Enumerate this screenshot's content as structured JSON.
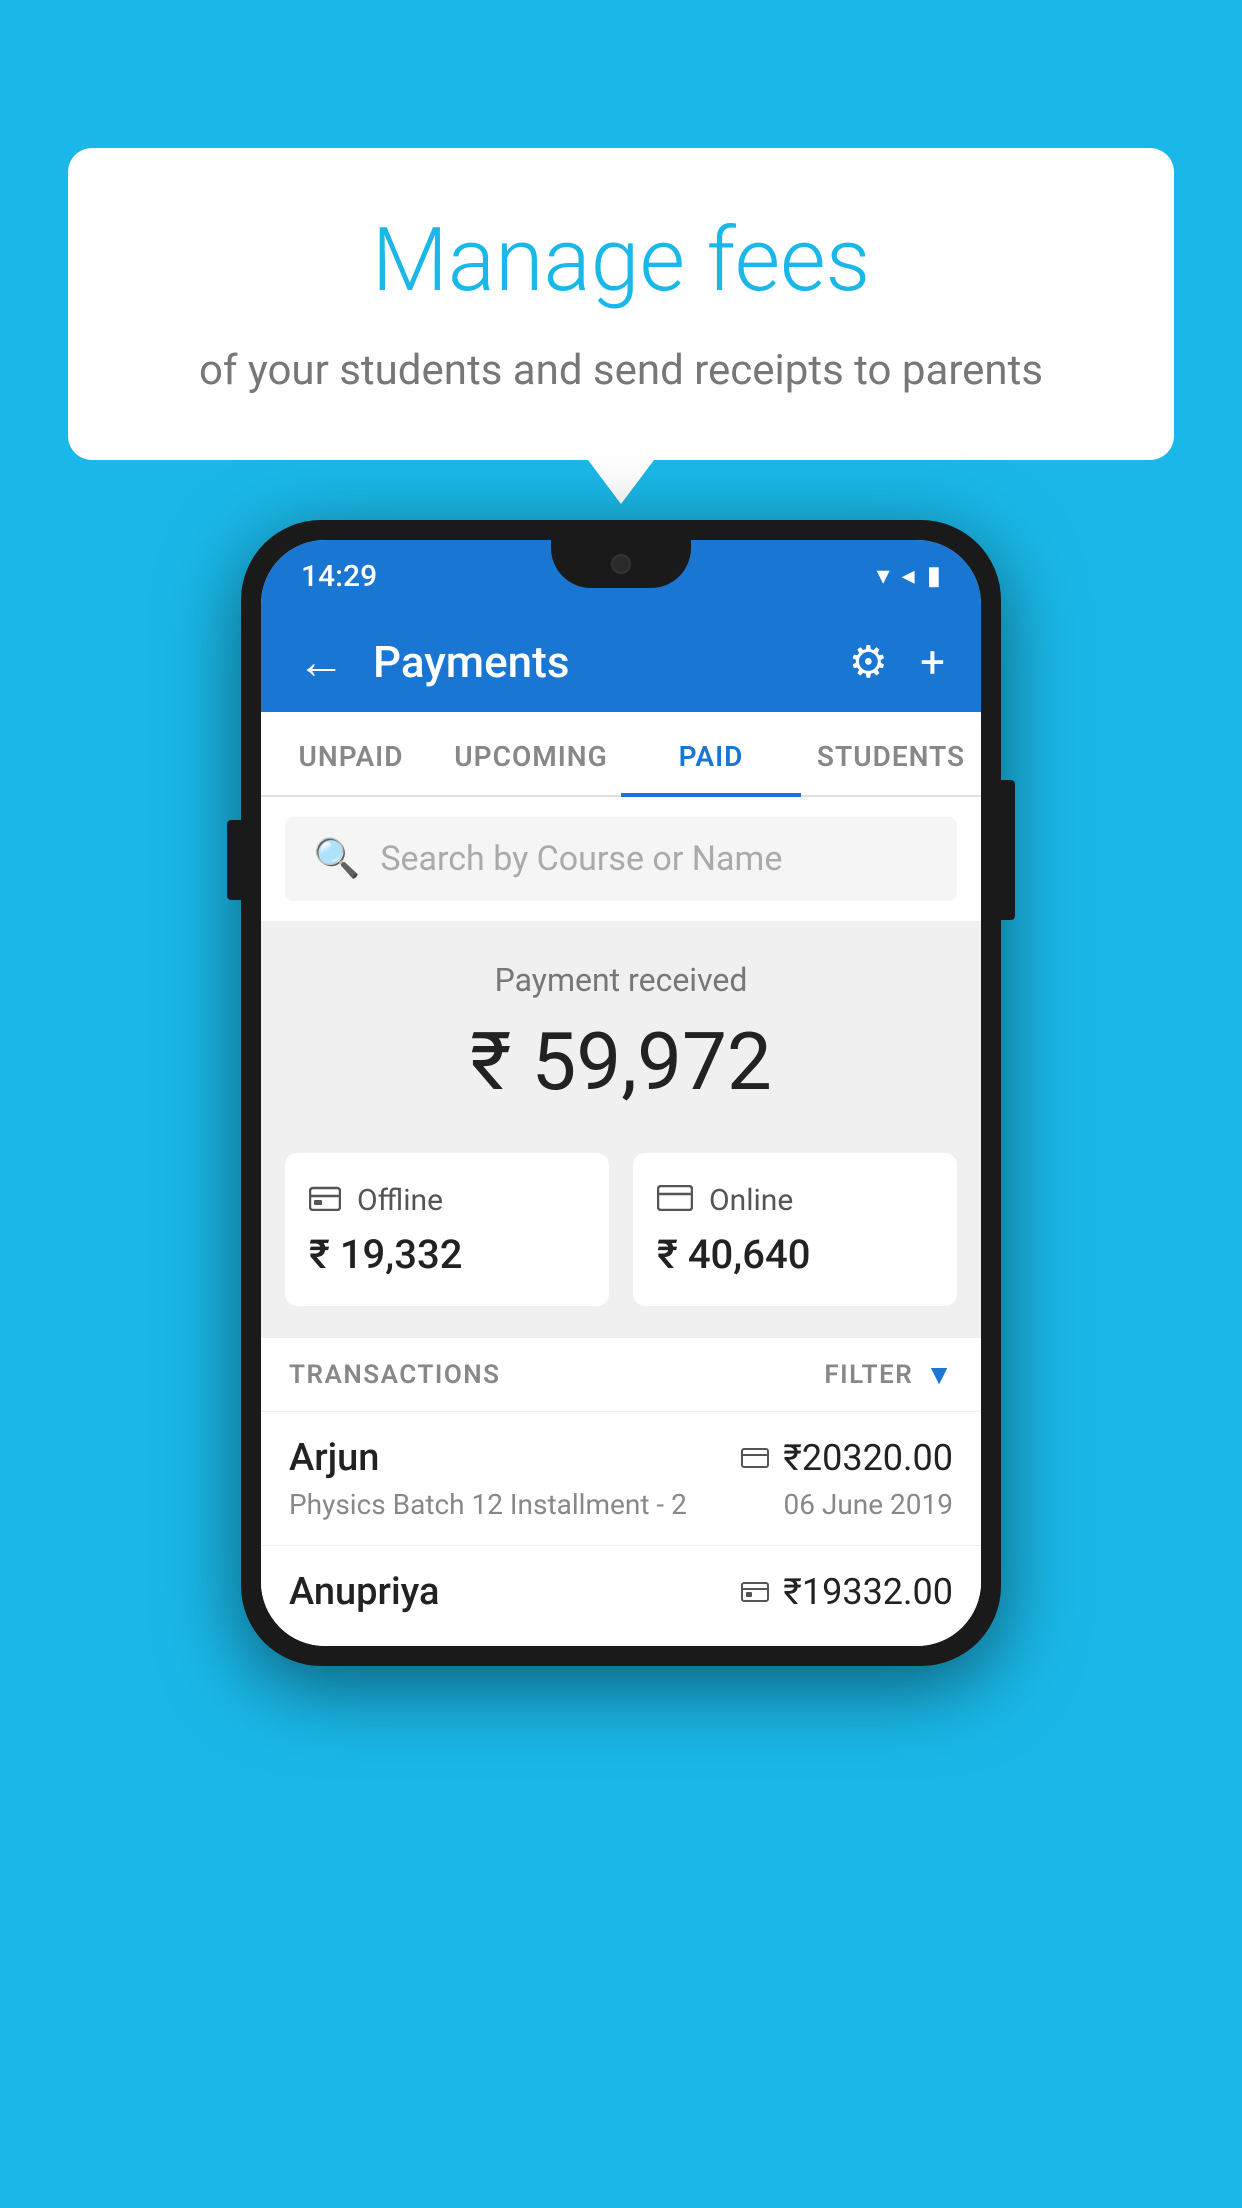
{
  "page": {
    "bg_color": "#1AB8E8"
  },
  "speech_bubble": {
    "title": "Manage fees",
    "subtitle": "of your students and send receipts to parents"
  },
  "phone": {
    "status_bar": {
      "time": "14:29",
      "icons": [
        "wifi",
        "signal",
        "battery"
      ]
    },
    "header": {
      "title": "Payments",
      "back_label": "←",
      "settings_label": "⚙",
      "add_label": "+"
    },
    "tabs": [
      {
        "id": "unpaid",
        "label": "UNPAID",
        "active": false
      },
      {
        "id": "upcoming",
        "label": "UPCOMING",
        "active": false
      },
      {
        "id": "paid",
        "label": "PAID",
        "active": true
      },
      {
        "id": "students",
        "label": "STUDENTS",
        "active": false
      }
    ],
    "search": {
      "placeholder": "Search by Course or Name"
    },
    "payment_received": {
      "label": "Payment received",
      "amount": "₹ 59,972"
    },
    "cards": [
      {
        "id": "offline",
        "icon": "💳",
        "type": "Offline",
        "amount": "₹ 19,332"
      },
      {
        "id": "online",
        "icon": "💳",
        "type": "Online",
        "amount": "₹ 40,640"
      }
    ],
    "transactions_header": {
      "label": "TRANSACTIONS",
      "filter_label": "FILTER"
    },
    "transactions": [
      {
        "name": "Arjun",
        "amount": "₹20320.00",
        "type_icon": "card",
        "course": "Physics Batch 12 Installment - 2",
        "date": "06 June 2019"
      },
      {
        "name": "Anupriya",
        "amount": "₹19332.00",
        "type_icon": "cash",
        "course": "",
        "date": ""
      }
    ]
  }
}
